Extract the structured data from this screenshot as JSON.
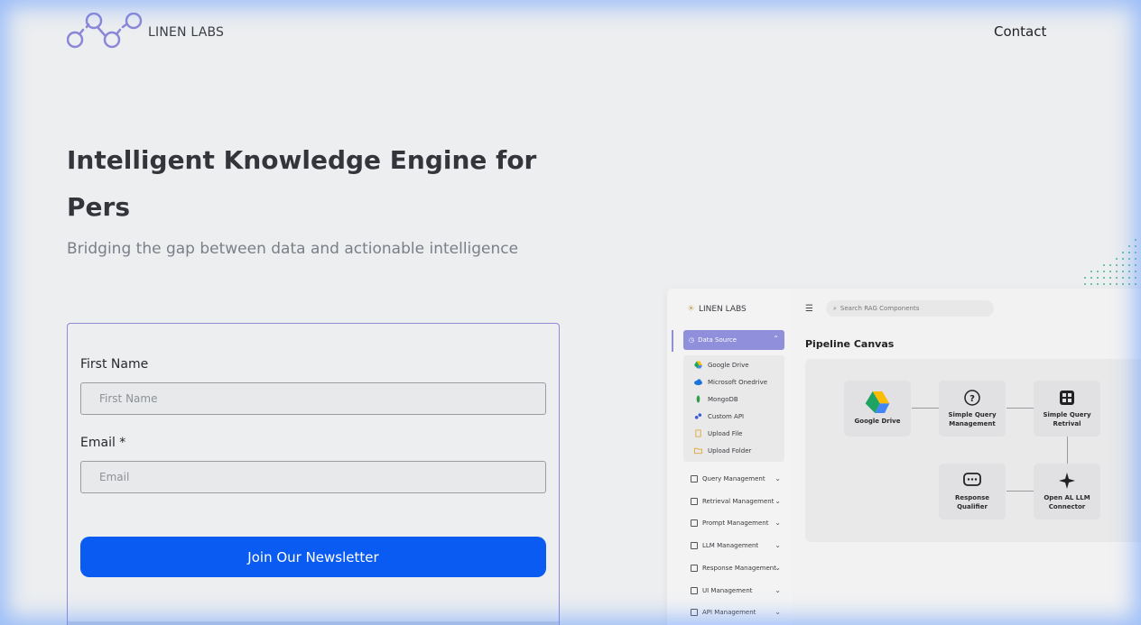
{
  "brand": {
    "name": "LINEN LABS"
  },
  "nav": {
    "contact": "Contact"
  },
  "hero": {
    "title": "Intelligent Knowledge Engine for Pers",
    "subtitle": "Bridging the gap between data and actionable intelligence"
  },
  "form": {
    "first_name_label": "First Name",
    "first_name_placeholder": "First Name",
    "email_label": "Email *",
    "email_placeholder": "Email",
    "submit_label": "Join Our Newsletter"
  },
  "preview": {
    "brand": "LINEN LABS",
    "search_placeholder": "Search RAG Components",
    "data_source_label": "Data Source",
    "data_sources": [
      {
        "label": "Google Drive",
        "icon": "google-drive-icon"
      },
      {
        "label": "Microsoft Onedrive",
        "icon": "onedrive-icon"
      },
      {
        "label": "MongoDB",
        "icon": "mongodb-icon"
      },
      {
        "label": "Custom API",
        "icon": "api-icon"
      },
      {
        "label": "Upload File",
        "icon": "file-icon"
      },
      {
        "label": "Upload Folder",
        "icon": "folder-icon"
      }
    ],
    "menu": [
      "Query Management",
      "Retrieval Management",
      "Prompt Management",
      "LLM Management",
      "Response Management",
      "UI Management",
      "API Management"
    ],
    "canvas_title": "Pipeline Canvas",
    "nodes": {
      "google_drive": "Google Drive",
      "simple_query_management": "Simple Query Management",
      "simple_query_retrival": "Simple Query Retrival",
      "response_qualifier": "Response Qualifier",
      "open_al_llm_connector": "Open AL LLM Connector"
    },
    "colors": {
      "accent": "#8f8fdc",
      "button": "#0a5bf2"
    }
  }
}
